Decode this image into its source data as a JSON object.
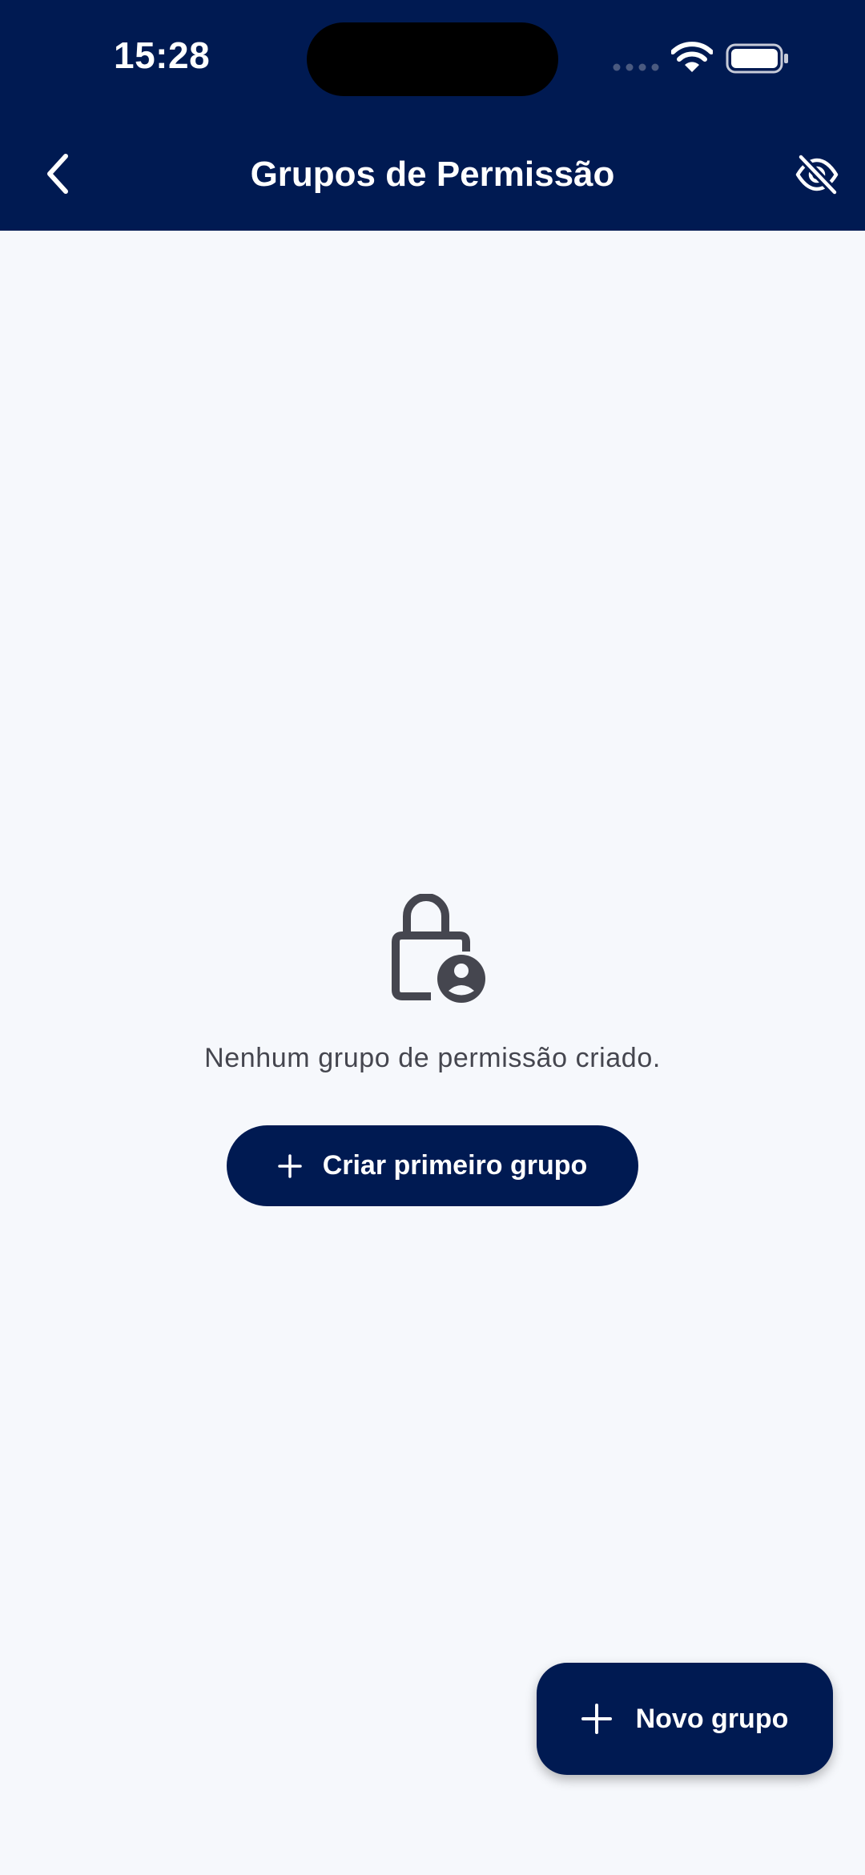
{
  "status_bar": {
    "time": "15:28",
    "icons": [
      "signal-dots-icon",
      "wifi-icon",
      "battery-icon"
    ]
  },
  "header": {
    "title": "Grupos de Permissão",
    "back_icon": "chevron-left-icon",
    "action_icon": "visibility-off-icon",
    "background": "#001a52"
  },
  "empty_state": {
    "icon": "lock-person-icon",
    "message": "Nenhum grupo de permissão criado.",
    "button_label": "Criar primeiro grupo",
    "button_icon": "plus-icon"
  },
  "fab": {
    "label": "Novo grupo",
    "icon": "plus-icon"
  },
  "colors": {
    "primary": "#001a52",
    "background": "#f6f8fc",
    "text_secondary": "#45464f",
    "icon": "#45464f"
  }
}
